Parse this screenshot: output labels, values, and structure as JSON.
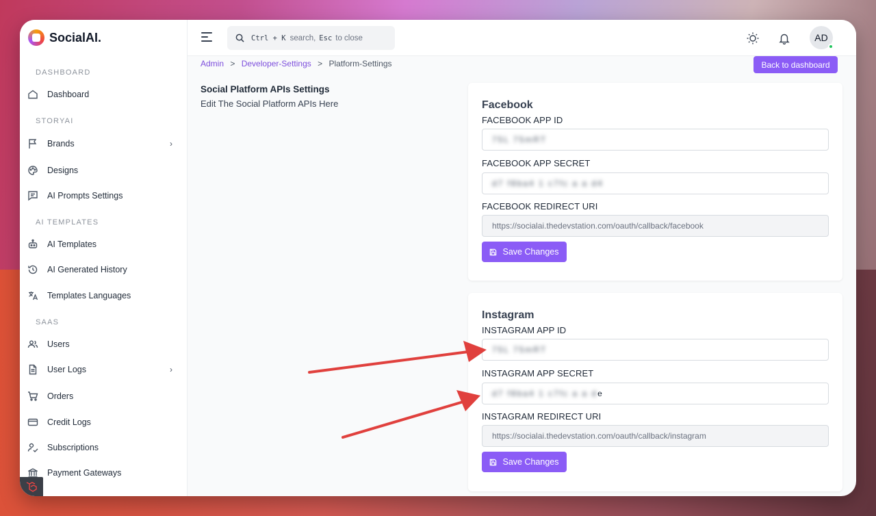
{
  "app": {
    "name": "SocialAI."
  },
  "sidebar": {
    "sections": [
      {
        "title": "DASHBOARD"
      },
      {
        "title": "STORYAI"
      },
      {
        "title": "AI TEMPLATES"
      },
      {
        "title": "SAAS"
      }
    ],
    "items": [
      {
        "label": "Dashboard",
        "icon": "home-icon"
      },
      {
        "label": "Brands",
        "icon": "flag-icon"
      },
      {
        "label": "Designs",
        "icon": "palette-icon"
      },
      {
        "label": "AI Prompts Settings",
        "icon": "message-icon"
      },
      {
        "label": "AI Templates",
        "icon": "robot-icon"
      },
      {
        "label": "AI Generated History",
        "icon": "history-icon"
      },
      {
        "label": "Templates Languages",
        "icon": "translate-icon"
      },
      {
        "label": "Users",
        "icon": "users-icon"
      },
      {
        "label": "User Logs",
        "icon": "document-icon"
      },
      {
        "label": "Orders",
        "icon": "cart-icon"
      },
      {
        "label": "Credit Logs",
        "icon": "credit-card-icon"
      },
      {
        "label": "Subscriptions",
        "icon": "user-check-icon"
      },
      {
        "label": "Payment Gateways",
        "icon": "bank-icon"
      }
    ]
  },
  "topbar": {
    "search_key": "Ctrl + K",
    "search_text": "search,",
    "search_esc": "Esc",
    "search_close": "to close",
    "avatar_initials": "AD"
  },
  "breadcrumb": {
    "items": [
      "Admin",
      "Developer-Settings",
      "Platform-Settings"
    ],
    "separator": ">"
  },
  "back_button": "Back to dashboard",
  "intro": {
    "title": "Social Platform APIs Settings",
    "subtitle": "Edit The Social Platform APIs Here"
  },
  "facebook": {
    "title": "Facebook",
    "app_id_label": "FACEBOOK APP ID",
    "app_id_value": "75L 75mRT",
    "app_secret_label": "FACEBOOK APP SECRET",
    "app_secret_value": "d7 f8ba4 1 c7fc a a d4",
    "redirect_label": "FACEBOOK REDIRECT URI",
    "redirect_value": "https://socialai.thedevstation.com/oauth/callback/facebook",
    "save_label": "Save Changes"
  },
  "instagram": {
    "title": "Instagram",
    "app_id_label": "INSTAGRAM APP ID",
    "app_id_value": "75L 75mRT",
    "app_secret_label": "INSTAGRAM APP SECRET",
    "app_secret_value": "d7 f8ba4 1 c7fc a a d",
    "app_secret_tail": "e",
    "redirect_label": "INSTAGRAM REDIRECT URI",
    "redirect_value": "https://socialai.thedevstation.com/oauth/callback/instagram",
    "save_label": "Save Changes"
  },
  "colors": {
    "accent": "#8b5cf6",
    "arrow": "#e0403d",
    "link": "#7c4ddc"
  }
}
